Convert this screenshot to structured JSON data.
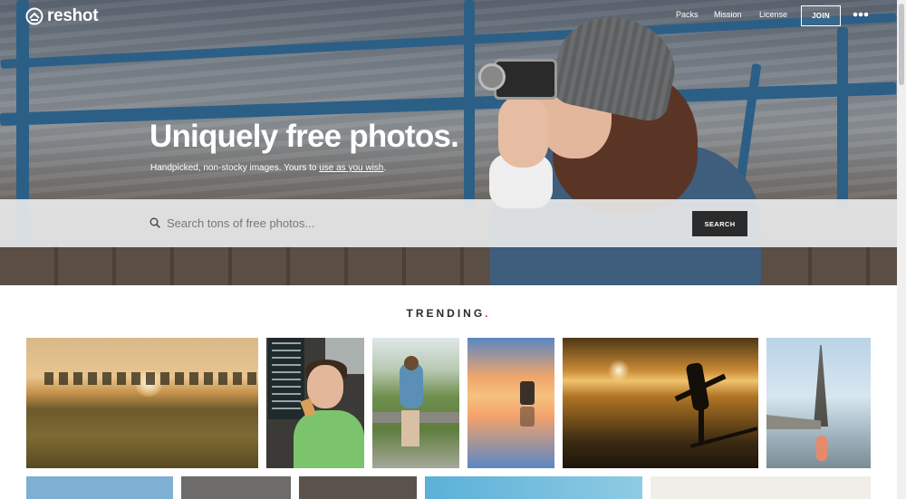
{
  "nav": {
    "logo_text": "reshot",
    "links": [
      {
        "label": "Packs"
      },
      {
        "label": "Mission"
      },
      {
        "label": "License"
      }
    ],
    "join_label": "JOIN",
    "more_icon": "more-horizontal-icon"
  },
  "hero": {
    "headline": "Uniquely free photos.",
    "subline_prefix": "Handpicked, non-stocky images. Yours to ",
    "subline_link": "use as you wish",
    "subline_suffix": "."
  },
  "search": {
    "placeholder": "Search tons of free photos...",
    "button_label": "SEARCH",
    "icon": "search-icon"
  },
  "trending": {
    "title": "TRENDING",
    "accent_dot": ".",
    "accent_color": "#e0334b"
  },
  "colors": {
    "search_button_bg": "#2b2b2b",
    "rail_blue": "#2c5f86"
  }
}
